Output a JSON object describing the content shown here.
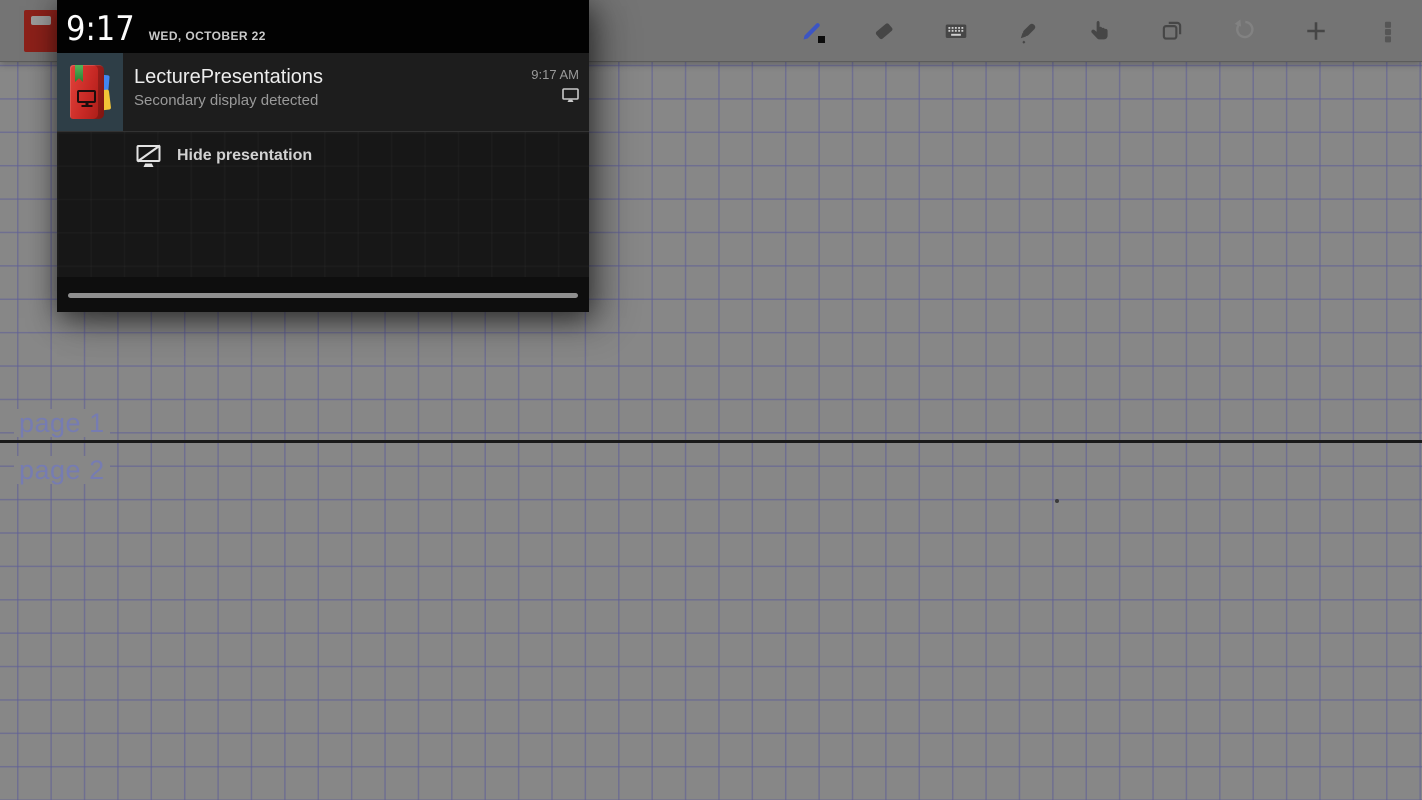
{
  "app": {
    "name": "LecturePresentations"
  },
  "canvas": {
    "page1_label": "page 1",
    "page2_label": "page 2",
    "background": "#878787",
    "grid_color": "#5f5f96",
    "divider_color": "#1a1a1a"
  },
  "toolbar": {
    "tools": [
      {
        "name": "pen",
        "icon": "pen-icon",
        "active": true,
        "color": "#3c55c4"
      },
      {
        "name": "eraser",
        "icon": "eraser-icon"
      },
      {
        "name": "keyboard",
        "icon": "keyboard-icon"
      },
      {
        "name": "highlighter",
        "icon": "highlighter-icon"
      },
      {
        "name": "hand",
        "icon": "hand-icon"
      },
      {
        "name": "duplicate-page",
        "icon": "pages-icon"
      },
      {
        "name": "undo",
        "icon": "undo-icon",
        "disabled": true
      },
      {
        "name": "add",
        "icon": "plus-icon"
      },
      {
        "name": "menu",
        "icon": "overflow-icon"
      }
    ],
    "icon_color": "#464646",
    "disabled_icon_color": "#828282"
  },
  "shade": {
    "time": "9:17",
    "date": "WED, OCTOBER 22",
    "notification": {
      "title": "LecturePresentations",
      "text": "Secondary display detected",
      "time": "9:17 AM",
      "icon": "lecture-presentations-book-icon",
      "status_icon": "display-icon"
    },
    "action_label": "Hide presentation",
    "action_icon": "display-off-icon"
  }
}
